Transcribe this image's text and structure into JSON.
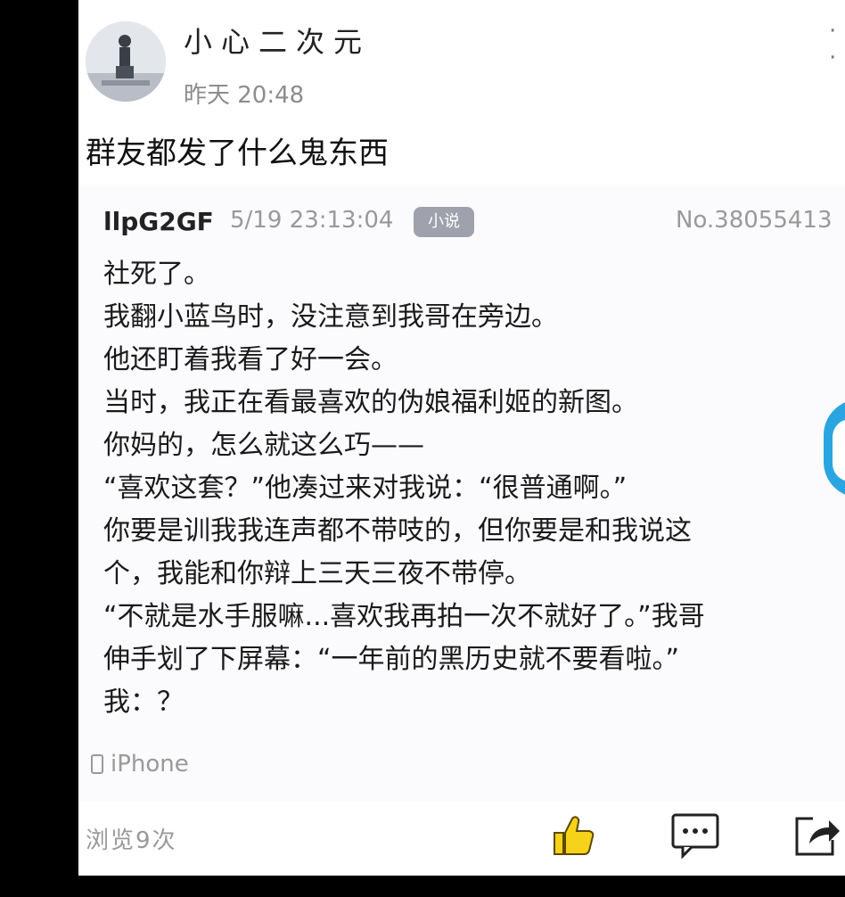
{
  "post": {
    "username": "小心二次元",
    "time": "昨天 20:48",
    "caption": "群友都发了什么鬼东西",
    "more_icon": "more-icon"
  },
  "quoted": {
    "user": "llpG2GF",
    "time": "5/19 23:13:04",
    "tag": "小说",
    "number": "No.38055413",
    "lines": [
      "社死了。",
      "我翻小蓝鸟时，没注意到我哥在旁边。",
      "他还盯着我看了好一会。",
      "当时，我正在看最喜欢的伪娘福利姬的新图。",
      "你妈的，怎么就这么巧——",
      "“喜欢这套？”他凑过来对我说：“很普通啊。”",
      "你要是训我我连声都不带吱的，但你要是和我说这",
      "个，我能和你辩上三天三夜不带停。",
      "“不就是水手服嘛...喜欢我再拍一次不就好了。”我哥",
      "伸手划了下屏幕：“一年前的黑历史就不要看啦。”",
      "我：？"
    ],
    "device": "iPhone"
  },
  "footer": {
    "views": "浏览9次"
  },
  "colors": {
    "like": "#f7d21a",
    "tag_bg": "#9fa1ad",
    "side_accent": "#2aa5e0"
  }
}
